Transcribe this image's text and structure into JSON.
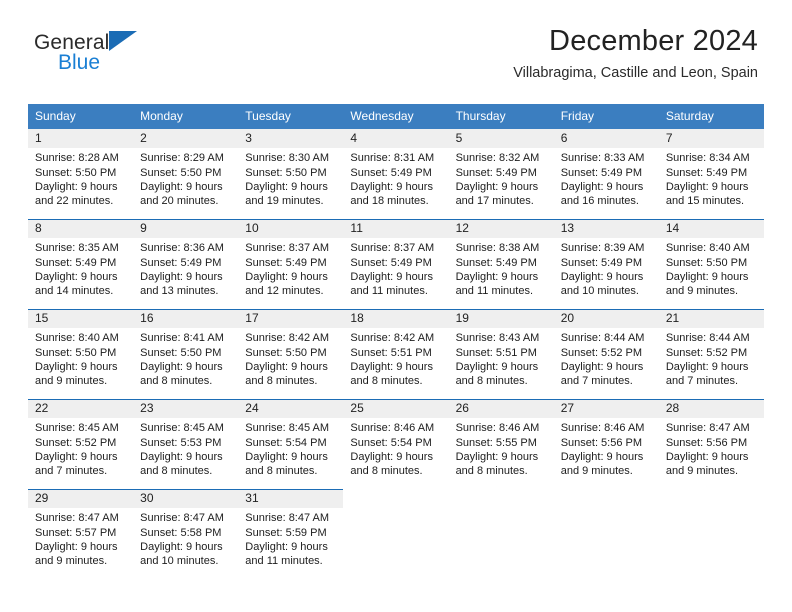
{
  "brand": {
    "name_top": "General",
    "name_bottom": "Blue",
    "accent_color": "#1b6cb5",
    "blue_text_color": "#1a7fd4"
  },
  "header": {
    "title": "December 2024",
    "subtitle": "Villabragima, Castille and Leon, Spain"
  },
  "colors": {
    "header_row_bg": "#3b7ec0",
    "daynum_band_bg": "#efefef",
    "row_rule": "#1b6cb5",
    "text": "#1d1d1d"
  },
  "weekdays": [
    "Sunday",
    "Monday",
    "Tuesday",
    "Wednesday",
    "Thursday",
    "Friday",
    "Saturday"
  ],
  "weeks": [
    [
      {
        "day": "1",
        "sunrise": "Sunrise: 8:28 AM",
        "sunset": "Sunset: 5:50 PM",
        "daylight_1": "Daylight: 9 hours",
        "daylight_2": "and 22 minutes."
      },
      {
        "day": "2",
        "sunrise": "Sunrise: 8:29 AM",
        "sunset": "Sunset: 5:50 PM",
        "daylight_1": "Daylight: 9 hours",
        "daylight_2": "and 20 minutes."
      },
      {
        "day": "3",
        "sunrise": "Sunrise: 8:30 AM",
        "sunset": "Sunset: 5:50 PM",
        "daylight_1": "Daylight: 9 hours",
        "daylight_2": "and 19 minutes."
      },
      {
        "day": "4",
        "sunrise": "Sunrise: 8:31 AM",
        "sunset": "Sunset: 5:49 PM",
        "daylight_1": "Daylight: 9 hours",
        "daylight_2": "and 18 minutes."
      },
      {
        "day": "5",
        "sunrise": "Sunrise: 8:32 AM",
        "sunset": "Sunset: 5:49 PM",
        "daylight_1": "Daylight: 9 hours",
        "daylight_2": "and 17 minutes."
      },
      {
        "day": "6",
        "sunrise": "Sunrise: 8:33 AM",
        "sunset": "Sunset: 5:49 PM",
        "daylight_1": "Daylight: 9 hours",
        "daylight_2": "and 16 minutes."
      },
      {
        "day": "7",
        "sunrise": "Sunrise: 8:34 AM",
        "sunset": "Sunset: 5:49 PM",
        "daylight_1": "Daylight: 9 hours",
        "daylight_2": "and 15 minutes."
      }
    ],
    [
      {
        "day": "8",
        "sunrise": "Sunrise: 8:35 AM",
        "sunset": "Sunset: 5:49 PM",
        "daylight_1": "Daylight: 9 hours",
        "daylight_2": "and 14 minutes."
      },
      {
        "day": "9",
        "sunrise": "Sunrise: 8:36 AM",
        "sunset": "Sunset: 5:49 PM",
        "daylight_1": "Daylight: 9 hours",
        "daylight_2": "and 13 minutes."
      },
      {
        "day": "10",
        "sunrise": "Sunrise: 8:37 AM",
        "sunset": "Sunset: 5:49 PM",
        "daylight_1": "Daylight: 9 hours",
        "daylight_2": "and 12 minutes."
      },
      {
        "day": "11",
        "sunrise": "Sunrise: 8:37 AM",
        "sunset": "Sunset: 5:49 PM",
        "daylight_1": "Daylight: 9 hours",
        "daylight_2": "and 11 minutes."
      },
      {
        "day": "12",
        "sunrise": "Sunrise: 8:38 AM",
        "sunset": "Sunset: 5:49 PM",
        "daylight_1": "Daylight: 9 hours",
        "daylight_2": "and 11 minutes."
      },
      {
        "day": "13",
        "sunrise": "Sunrise: 8:39 AM",
        "sunset": "Sunset: 5:49 PM",
        "daylight_1": "Daylight: 9 hours",
        "daylight_2": "and 10 minutes."
      },
      {
        "day": "14",
        "sunrise": "Sunrise: 8:40 AM",
        "sunset": "Sunset: 5:50 PM",
        "daylight_1": "Daylight: 9 hours",
        "daylight_2": "and 9 minutes."
      }
    ],
    [
      {
        "day": "15",
        "sunrise": "Sunrise: 8:40 AM",
        "sunset": "Sunset: 5:50 PM",
        "daylight_1": "Daylight: 9 hours",
        "daylight_2": "and 9 minutes."
      },
      {
        "day": "16",
        "sunrise": "Sunrise: 8:41 AM",
        "sunset": "Sunset: 5:50 PM",
        "daylight_1": "Daylight: 9 hours",
        "daylight_2": "and 8 minutes."
      },
      {
        "day": "17",
        "sunrise": "Sunrise: 8:42 AM",
        "sunset": "Sunset: 5:50 PM",
        "daylight_1": "Daylight: 9 hours",
        "daylight_2": "and 8 minutes."
      },
      {
        "day": "18",
        "sunrise": "Sunrise: 8:42 AM",
        "sunset": "Sunset: 5:51 PM",
        "daylight_1": "Daylight: 9 hours",
        "daylight_2": "and 8 minutes."
      },
      {
        "day": "19",
        "sunrise": "Sunrise: 8:43 AM",
        "sunset": "Sunset: 5:51 PM",
        "daylight_1": "Daylight: 9 hours",
        "daylight_2": "and 8 minutes."
      },
      {
        "day": "20",
        "sunrise": "Sunrise: 8:44 AM",
        "sunset": "Sunset: 5:52 PM",
        "daylight_1": "Daylight: 9 hours",
        "daylight_2": "and 7 minutes."
      },
      {
        "day": "21",
        "sunrise": "Sunrise: 8:44 AM",
        "sunset": "Sunset: 5:52 PM",
        "daylight_1": "Daylight: 9 hours",
        "daylight_2": "and 7 minutes."
      }
    ],
    [
      {
        "day": "22",
        "sunrise": "Sunrise: 8:45 AM",
        "sunset": "Sunset: 5:52 PM",
        "daylight_1": "Daylight: 9 hours",
        "daylight_2": "and 7 minutes."
      },
      {
        "day": "23",
        "sunrise": "Sunrise: 8:45 AM",
        "sunset": "Sunset: 5:53 PM",
        "daylight_1": "Daylight: 9 hours",
        "daylight_2": "and 8 minutes."
      },
      {
        "day": "24",
        "sunrise": "Sunrise: 8:45 AM",
        "sunset": "Sunset: 5:54 PM",
        "daylight_1": "Daylight: 9 hours",
        "daylight_2": "and 8 minutes."
      },
      {
        "day": "25",
        "sunrise": "Sunrise: 8:46 AM",
        "sunset": "Sunset: 5:54 PM",
        "daylight_1": "Daylight: 9 hours",
        "daylight_2": "and 8 minutes."
      },
      {
        "day": "26",
        "sunrise": "Sunrise: 8:46 AM",
        "sunset": "Sunset: 5:55 PM",
        "daylight_1": "Daylight: 9 hours",
        "daylight_2": "and 8 minutes."
      },
      {
        "day": "27",
        "sunrise": "Sunrise: 8:46 AM",
        "sunset": "Sunset: 5:56 PM",
        "daylight_1": "Daylight: 9 hours",
        "daylight_2": "and 9 minutes."
      },
      {
        "day": "28",
        "sunrise": "Sunrise: 8:47 AM",
        "sunset": "Sunset: 5:56 PM",
        "daylight_1": "Daylight: 9 hours",
        "daylight_2": "and 9 minutes."
      }
    ],
    [
      {
        "day": "29",
        "sunrise": "Sunrise: 8:47 AM",
        "sunset": "Sunset: 5:57 PM",
        "daylight_1": "Daylight: 9 hours",
        "daylight_2": "and 9 minutes."
      },
      {
        "day": "30",
        "sunrise": "Sunrise: 8:47 AM",
        "sunset": "Sunset: 5:58 PM",
        "daylight_1": "Daylight: 9 hours",
        "daylight_2": "and 10 minutes."
      },
      {
        "day": "31",
        "sunrise": "Sunrise: 8:47 AM",
        "sunset": "Sunset: 5:59 PM",
        "daylight_1": "Daylight: 9 hours",
        "daylight_2": "and 11 minutes."
      },
      {
        "day": "",
        "sunrise": "",
        "sunset": "",
        "daylight_1": "",
        "daylight_2": ""
      },
      {
        "day": "",
        "sunrise": "",
        "sunset": "",
        "daylight_1": "",
        "daylight_2": ""
      },
      {
        "day": "",
        "sunrise": "",
        "sunset": "",
        "daylight_1": "",
        "daylight_2": ""
      },
      {
        "day": "",
        "sunrise": "",
        "sunset": "",
        "daylight_1": "",
        "daylight_2": ""
      }
    ]
  ]
}
